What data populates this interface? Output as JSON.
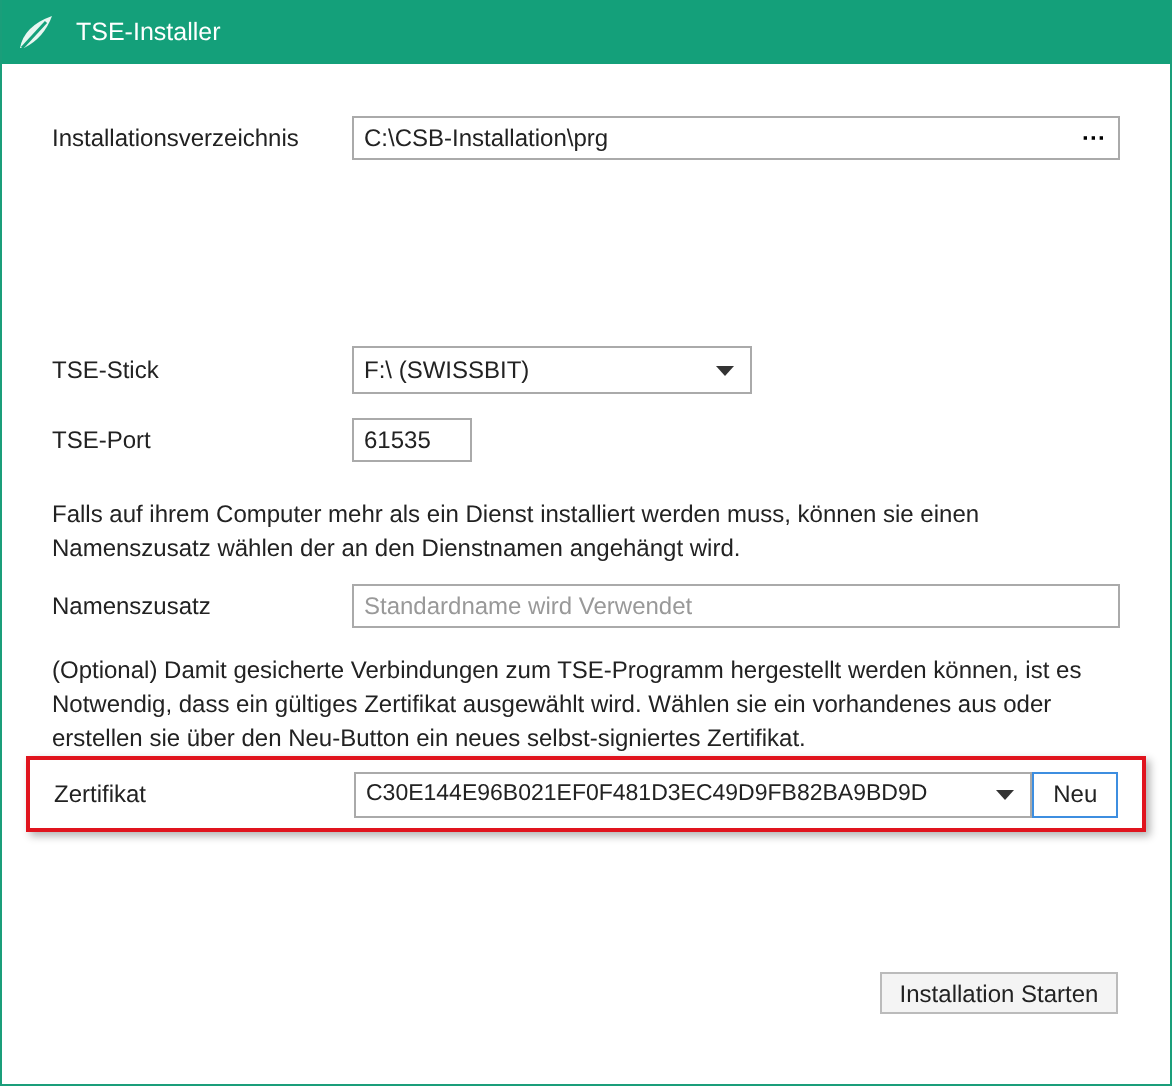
{
  "window": {
    "title": "TSE-Installer"
  },
  "install_dir": {
    "label": "Installationsverzeichnis",
    "value": "C:\\CSB-Installation\\prg",
    "browse_button": "···"
  },
  "tse_stick": {
    "label": "TSE-Stick",
    "value": "F:\\ (SWISSBIT)"
  },
  "tse_port": {
    "label": "TSE-Port",
    "value": "61535"
  },
  "name_hint": "Falls auf ihrem Computer mehr als ein Dienst installiert werden muss, können sie einen Namenszusatz wählen der an den Dienstnamen angehängt wird.",
  "name_suffix": {
    "label": "Namenszusatz",
    "placeholder": "Standardname wird Verwendet"
  },
  "cert_hint": "(Optional) Damit gesicherte Verbindungen zum TSE-Programm hergestellt werden können, ist es Notwendig, dass ein gültiges Zertifikat ausgewählt wird. Wählen sie ein vorhandenes aus oder erstellen sie über den Neu-Button ein neues selbst-signiertes Zertifikat.",
  "certificate": {
    "label": "Zertifikat",
    "value": "C30E144E96B021EF0F481D3EC49D9FB82BA9BD9D",
    "new_button": "Neu",
    "highlighted": true
  },
  "install_button": "Installation Starten"
}
